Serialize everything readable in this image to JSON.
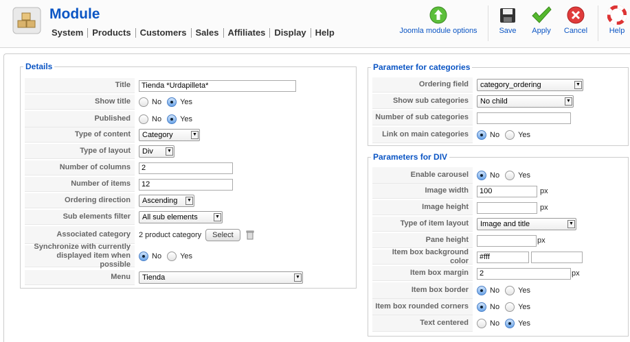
{
  "header": {
    "title": "Module"
  },
  "menu": [
    "System",
    "Products",
    "Customers",
    "Sales",
    "Affiliates",
    "Display",
    "Help"
  ],
  "toolbar": {
    "module_options": "Joomla module options",
    "save": "Save",
    "apply": "Apply",
    "cancel": "Cancel",
    "help": "Help"
  },
  "details": {
    "legend": "Details",
    "title": {
      "label": "Title",
      "value": "Tienda *Urdapilleta*"
    },
    "show_title": {
      "label": "Show title",
      "selected": "Yes"
    },
    "published": {
      "label": "Published",
      "selected": "Yes"
    },
    "type_of_content": {
      "label": "Type of content",
      "value": "Category"
    },
    "type_of_layout": {
      "label": "Type of layout",
      "value": "Div"
    },
    "number_of_columns": {
      "label": "Number of columns",
      "value": "2"
    },
    "number_of_items": {
      "label": "Number of items",
      "value": "12"
    },
    "ordering_direction": {
      "label": "Ordering direction",
      "value": "Ascending"
    },
    "sub_elements_filter": {
      "label": "Sub elements filter",
      "value": "All sub elements"
    },
    "associated_category": {
      "label": "Associated category",
      "value": "2 product category",
      "button": "Select"
    },
    "synchronize": {
      "label": "Synchronize with currently displayed item when possible",
      "selected": "No"
    },
    "menu": {
      "label": "Menu",
      "value": "Tienda"
    }
  },
  "categories": {
    "legend": "Parameter for categories",
    "ordering_field": {
      "label": "Ordering field",
      "value": "category_ordering"
    },
    "show_sub_categories": {
      "label": "Show sub categories",
      "value": "No child"
    },
    "number_of_sub_categories": {
      "label": "Number of sub categories",
      "value": ""
    },
    "link_on_main": {
      "label": "Link on main categories",
      "selected": "No"
    }
  },
  "div": {
    "legend": "Parameters for DIV",
    "enable_carousel": {
      "label": "Enable carousel",
      "selected": "No"
    },
    "image_width": {
      "label": "Image width",
      "value": "100",
      "unit": "px"
    },
    "image_height": {
      "label": "Image height",
      "value": "",
      "unit": "px"
    },
    "type_of_item_layout": {
      "label": "Type of item layout",
      "value": "Image and title"
    },
    "pane_height": {
      "label": "Pane height",
      "value": "",
      "unit": "px"
    },
    "item_box_bg": {
      "label": "Item box background color",
      "value": "#fff",
      "value2": ""
    },
    "item_box_margin": {
      "label": "Item box margin",
      "value": "2",
      "unit": "px"
    },
    "item_box_border": {
      "label": "Item box border",
      "selected": "No"
    },
    "item_box_rounded": {
      "label": "Item box rounded corners",
      "selected": "No"
    },
    "text_centered": {
      "label": "Text centered",
      "selected": "Yes"
    }
  },
  "radio_options": {
    "no": "No",
    "yes": "Yes"
  },
  "icons": [
    "module-logo-icon",
    "module-options-icon",
    "save-icon",
    "apply-icon",
    "cancel-icon",
    "help-icon",
    "trash-icon"
  ],
  "colors": {
    "title_blue": "#0b55c4",
    "label_bg": "#f6f6f6",
    "border": "#cccccc"
  }
}
